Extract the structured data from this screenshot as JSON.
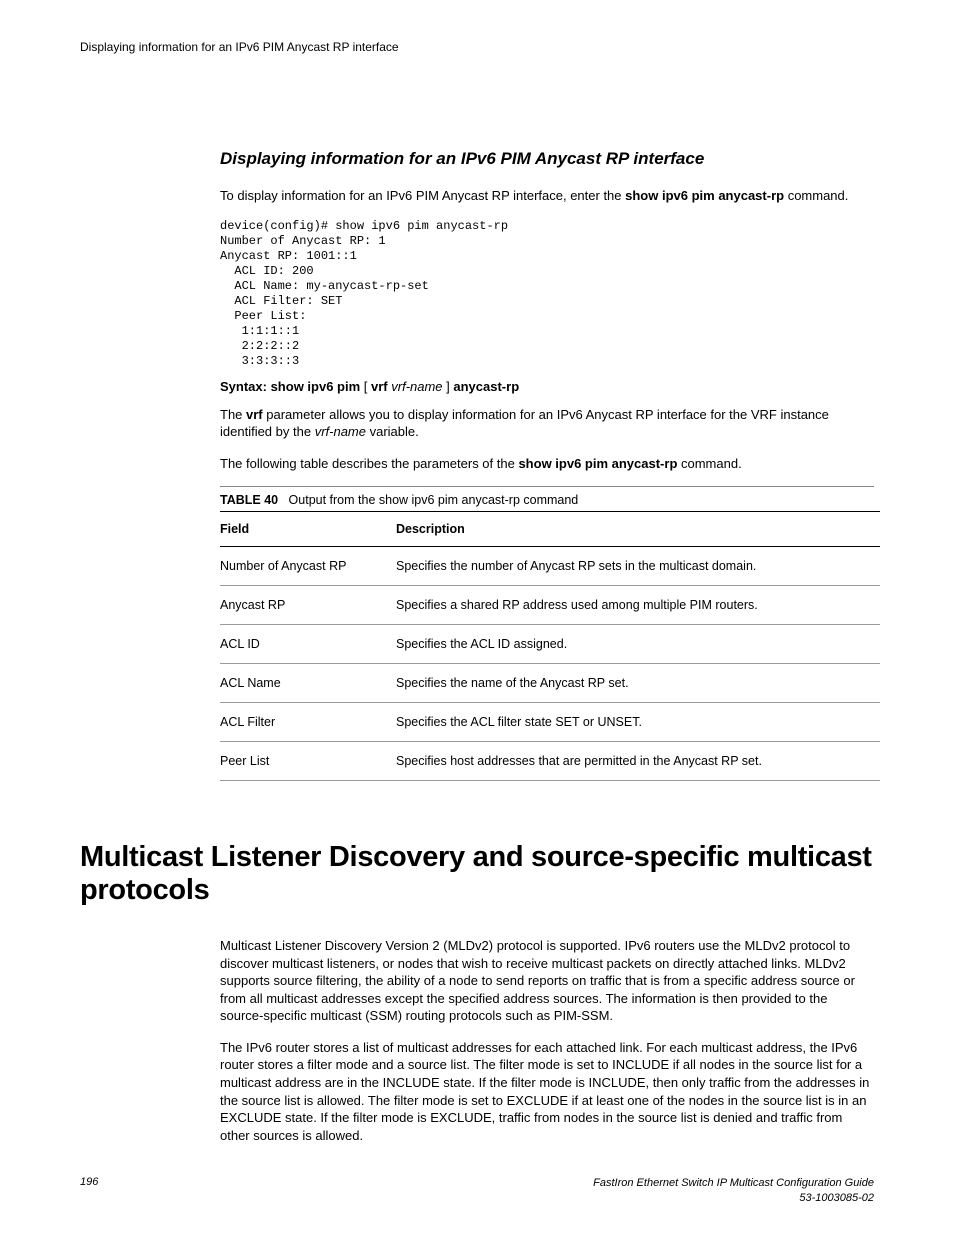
{
  "running_head": "Displaying information for an IPv6 PIM Anycast RP interface",
  "section_title": "Displaying information for an IPv6 PIM Anycast RP interface",
  "intro_prefix": "To display information for an IPv6 PIM Anycast RP interface, enter the ",
  "intro_cmd": "show ipv6 pim anycast-rp",
  "intro_suffix": " command.",
  "code_block": "device(config)# show ipv6 pim anycast-rp\nNumber of Anycast RP: 1\nAnycast RP: 1001::1\n  ACL ID: 200\n  ACL Name: my-anycast-rp-set\n  ACL Filter: SET\n  Peer List:\n   1:1:1::1\n   2:2:2::2\n   3:3:3::3",
  "syntax": {
    "label": "Syntax: ",
    "cmd1": "show ipv6 pim",
    "bracket_open": " [ ",
    "vrf": "vrf",
    "space": " ",
    "vrf_name": "vrf-name",
    "bracket_close": " ] ",
    "cmd2": "anycast-rp"
  },
  "vrf_para_1a": "The ",
  "vrf_para_1b": "vrf",
  "vrf_para_1c": " parameter allows you to display information for an IPv6 Anycast RP interface for the VRF instance identified by the ",
  "vrf_para_1d": "vrf-name",
  "vrf_para_1e": " variable.",
  "table_intro_a": "The following table describes the parameters of the ",
  "table_intro_b": "show ipv6 pim anycast-rp",
  "table_intro_c": " command.",
  "table_caption_label": "TABLE 40",
  "table_caption_text": "Output from the show ipv6 pim anycast-rp command",
  "table": {
    "head_field": "Field",
    "head_desc": "Description",
    "rows": [
      {
        "field": "Number of Anycast RP",
        "desc": "Specifies the number of Anycast RP sets in the multicast domain."
      },
      {
        "field": "Anycast RP",
        "desc": "Specifies a shared RP address used among multiple PIM routers."
      },
      {
        "field": "ACL ID",
        "desc": "Specifies the ACL ID assigned."
      },
      {
        "field": "ACL Name",
        "desc": "Specifies the name of the Anycast RP set."
      },
      {
        "field": "ACL Filter",
        "desc": "Specifies the ACL filter state SET or UNSET."
      },
      {
        "field": "Peer List",
        "desc": "Specifies host addresses that are permitted in the Anycast RP set."
      }
    ]
  },
  "chapter_title": "Multicast Listener Discovery and source-specific multicast protocols",
  "mld_p1": "Multicast Listener Discovery Version 2 (MLDv2) protocol is supported. IPv6 routers use the MLDv2 protocol to discover multicast listeners, or nodes that wish to receive multicast packets on directly attached links. MLDv2 supports source filtering, the ability of a node to send reports on traffic that is from a specific address source or from all multicast addresses except the specified address sources. The information is then provided to the source-specific multicast (SSM) routing protocols such as PIM-SSM.",
  "mld_p2": "The IPv6 router stores a list of multicast addresses for each attached link. For each multicast address, the IPv6 router stores a filter mode and a source list. The filter mode is set to INCLUDE if all nodes in the source list for a multicast address are in the INCLUDE state. If the filter mode is INCLUDE, then only traffic from the addresses in the source list is allowed. The filter mode is set to EXCLUDE if at least one of the nodes in the source list is in an EXCLUDE state. If the filter mode is EXCLUDE, traffic from nodes in the source list is denied and traffic from other sources is allowed.",
  "footer": {
    "page_no": "196",
    "guide": "FastIron Ethernet Switch IP Multicast Configuration Guide",
    "docnum": "53-1003085-02"
  }
}
